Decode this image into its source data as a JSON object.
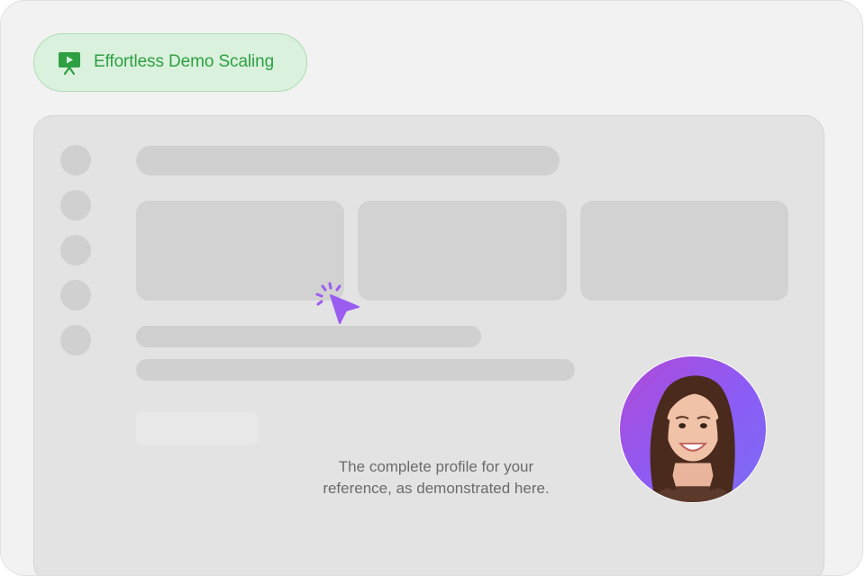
{
  "badge": {
    "label": "Effortless Demo Scaling",
    "icon": "presentation-icon",
    "text_color": "#2ea043",
    "background": "#daf1dd"
  },
  "cursor": {
    "icon": "click-cursor-icon",
    "color": "#9b5cf0"
  },
  "caption": {
    "line1": "The complete profile for your",
    "line2": "reference, as demonstrated here."
  },
  "avatar": {
    "icon": "presenter-avatar",
    "background": "#a24fe0"
  }
}
